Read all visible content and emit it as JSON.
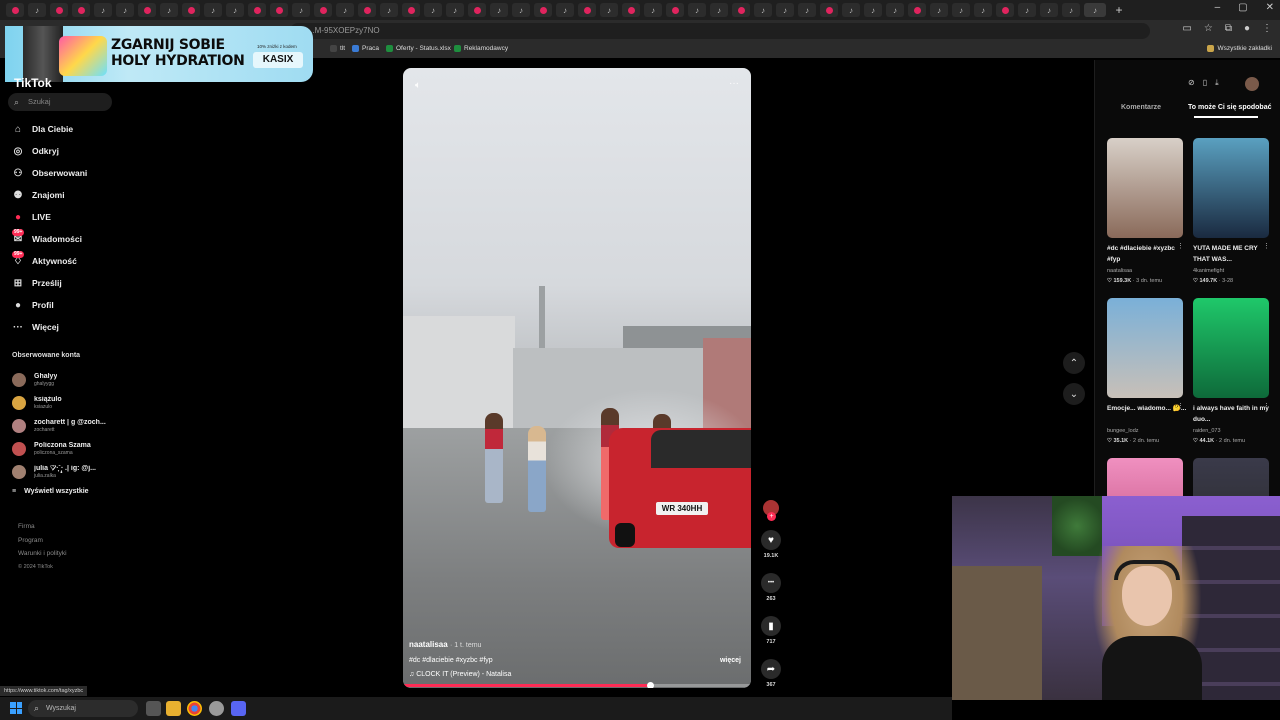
{
  "browser": {
    "url": "...M-95XOEPzy7NO",
    "bookmarks": [
      {
        "label": "tlt",
        "color": "#444444"
      },
      {
        "label": "Praca",
        "color": "#3a7bd5"
      },
      {
        "label": "Oferty - Status.xlsx",
        "color": "#1e8e3e"
      },
      {
        "label": "Reklamodawcy",
        "color": "#1e8e3e"
      }
    ],
    "all_bookmarks": "Wszystkie zakładki"
  },
  "ad": {
    "line1": "ZGARNIJ SOBIE",
    "line2": "HOLY HYDRATION",
    "small": "10% zniżki z kodem",
    "button": "KASIX"
  },
  "sidebar": {
    "logo": "TikTok",
    "search_placeholder": "Szukaj",
    "nav": [
      {
        "label": "Dla Ciebie",
        "icon": "home-icon",
        "glyph": "⌂"
      },
      {
        "label": "Odkryj",
        "icon": "compass-icon",
        "glyph": "◎"
      },
      {
        "label": "Obserwowani",
        "icon": "user-plus-icon",
        "glyph": "⚇"
      },
      {
        "label": "Znajomi",
        "icon": "friends-icon",
        "glyph": "⚉"
      },
      {
        "label": "LIVE",
        "icon": "live-icon",
        "glyph": "●"
      },
      {
        "label": "Wiadomości",
        "icon": "message-icon",
        "glyph": "✉",
        "badge": "99+"
      },
      {
        "label": "Aktywność",
        "icon": "bell-icon",
        "glyph": "♢",
        "badge": "99+"
      },
      {
        "label": "Prześlij",
        "icon": "upload-icon",
        "glyph": "⊞"
      },
      {
        "label": "Profil",
        "icon": "profile-icon",
        "glyph": "●"
      },
      {
        "label": "Więcej",
        "icon": "more-icon",
        "glyph": "···"
      }
    ],
    "follow_title": "Obserwowane konta",
    "follows": [
      {
        "name": "Ghalyy",
        "handle": "ghalyygg",
        "color": "#8a6a5a"
      },
      {
        "name": "książulo",
        "handle": "ksiazulo",
        "color": "#d9a441"
      },
      {
        "name": "zocharett | g @zoch...",
        "handle": "zocharett",
        "color": "#b08080"
      },
      {
        "name": "Policzona Szama",
        "handle": "policzona_szama",
        "color": "#c05050"
      },
      {
        "name": "julia ♡̷·̩͙˚‧̩̥ .| ig: @j...",
        "handle": "julia.zalka",
        "color": "#a08070"
      }
    ],
    "show_all": "Wyświetl wszystkie",
    "footer": [
      "Firma",
      "Program",
      "Warunki i polityki",
      "© 2024 TikTok"
    ]
  },
  "video": {
    "plate": "WR 340HH",
    "username": "naatalisaa",
    "time": "· 1 t. temu",
    "tags": "#dc #dlaciebie #xyzbc #fyp",
    "more": "więcej",
    "music": "♫  CLOCK IT (Preview) - Natalisa",
    "progress": 0.71,
    "actions": [
      {
        "icon": "heart-icon",
        "glyph": "♥",
        "count": "19.1K"
      },
      {
        "icon": "comment-icon",
        "glyph": "•••",
        "count": "263"
      },
      {
        "icon": "bookmark-icon",
        "glyph": "▮",
        "count": "717"
      },
      {
        "icon": "share-icon",
        "glyph": "➦",
        "count": "367"
      }
    ]
  },
  "right_panel": {
    "tabs": {
      "comments": "Komentarze",
      "suggested": "To może Ci się spodobać"
    },
    "thumbs": [
      {
        "caption": "#dc #dlaciebie #xyzbc #fyp",
        "user": "naatalisaa",
        "likes": "159.3K",
        "date": "3 dn. temu",
        "bg": "linear-gradient(180deg,#d8d0c8,#8a6a5a)"
      },
      {
        "caption": "YUTA MADE ME CRY THAT WAS...",
        "user": "4kanimefight",
        "likes": "149.7K",
        "date": "3-28",
        "bg": "linear-gradient(180deg,#5aa0c0,#1a2a40)"
      },
      {
        "caption": "Emocje... wiadomo... 🤔...",
        "user": "bungee_lodz",
        "likes": "35.1K",
        "date": "2 dn. temu",
        "bg": "linear-gradient(180deg,#7ab0d8,#c8c0b8)"
      },
      {
        "caption": "i always have faith in my duo...",
        "user": "raiden_073",
        "likes": "44.1K",
        "date": "2 dn. temu",
        "bg": "linear-gradient(180deg,#1fc86a,#0e6a3a)"
      },
      {
        "caption": "",
        "user": "",
        "likes": "",
        "date": "",
        "bg": "linear-gradient(180deg,#f090c0,#c05080)"
      },
      {
        "caption": "",
        "user": "",
        "likes": "",
        "date": "",
        "bg": "linear-gradient(180deg,#3a3a4a,#2a2a2a)"
      }
    ]
  },
  "taskbar": {
    "search": "Wyszukaj"
  },
  "status_url": "https://www.tiktok.com/tag/xyzbc"
}
